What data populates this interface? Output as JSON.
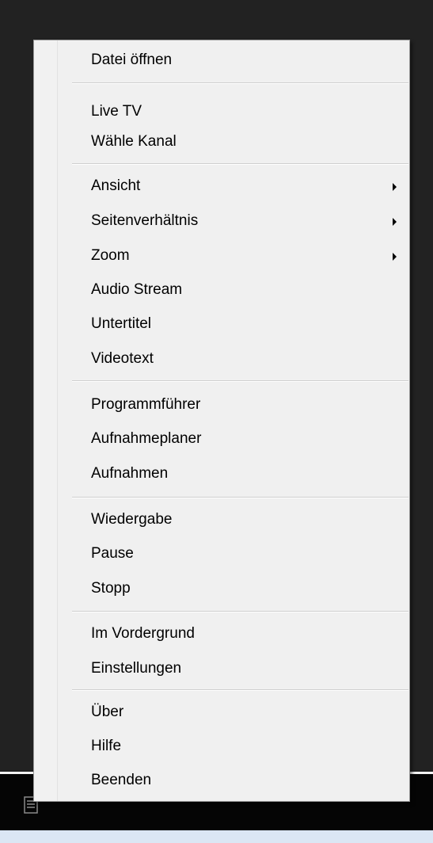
{
  "context_menu": {
    "items": [
      {
        "label": "Datei öffnen"
      },
      {
        "label": "Live TV"
      },
      {
        "label": "Wähle Kanal"
      },
      {
        "label": "Ansicht",
        "submenu": true
      },
      {
        "label": "Seitenverhältnis",
        "submenu": true
      },
      {
        "label": "Zoom",
        "submenu": true
      },
      {
        "label": "Audio Stream"
      },
      {
        "label": "Untertitel"
      },
      {
        "label": "Videotext"
      },
      {
        "label": "Programmführer"
      },
      {
        "label": "Aufnahmeplaner"
      },
      {
        "label": "Aufnahmen"
      },
      {
        "label": "Wiedergabe"
      },
      {
        "label": "Pause"
      },
      {
        "label": "Stopp"
      },
      {
        "label": "Im Vordergrund"
      },
      {
        "label": "Einstellungen"
      },
      {
        "label": "Über"
      },
      {
        "label": "Hilfe"
      },
      {
        "label": "Beenden"
      }
    ]
  },
  "taskbar": {
    "icon": "document-icon"
  },
  "colors": {
    "background": "#222222",
    "menu_background": "#f0f0f0",
    "menu_border": "#979797",
    "separator": "#cfcfcf",
    "text": "#000000",
    "taskbar": "#050505",
    "bottom_strip": "#dbe6f4"
  }
}
